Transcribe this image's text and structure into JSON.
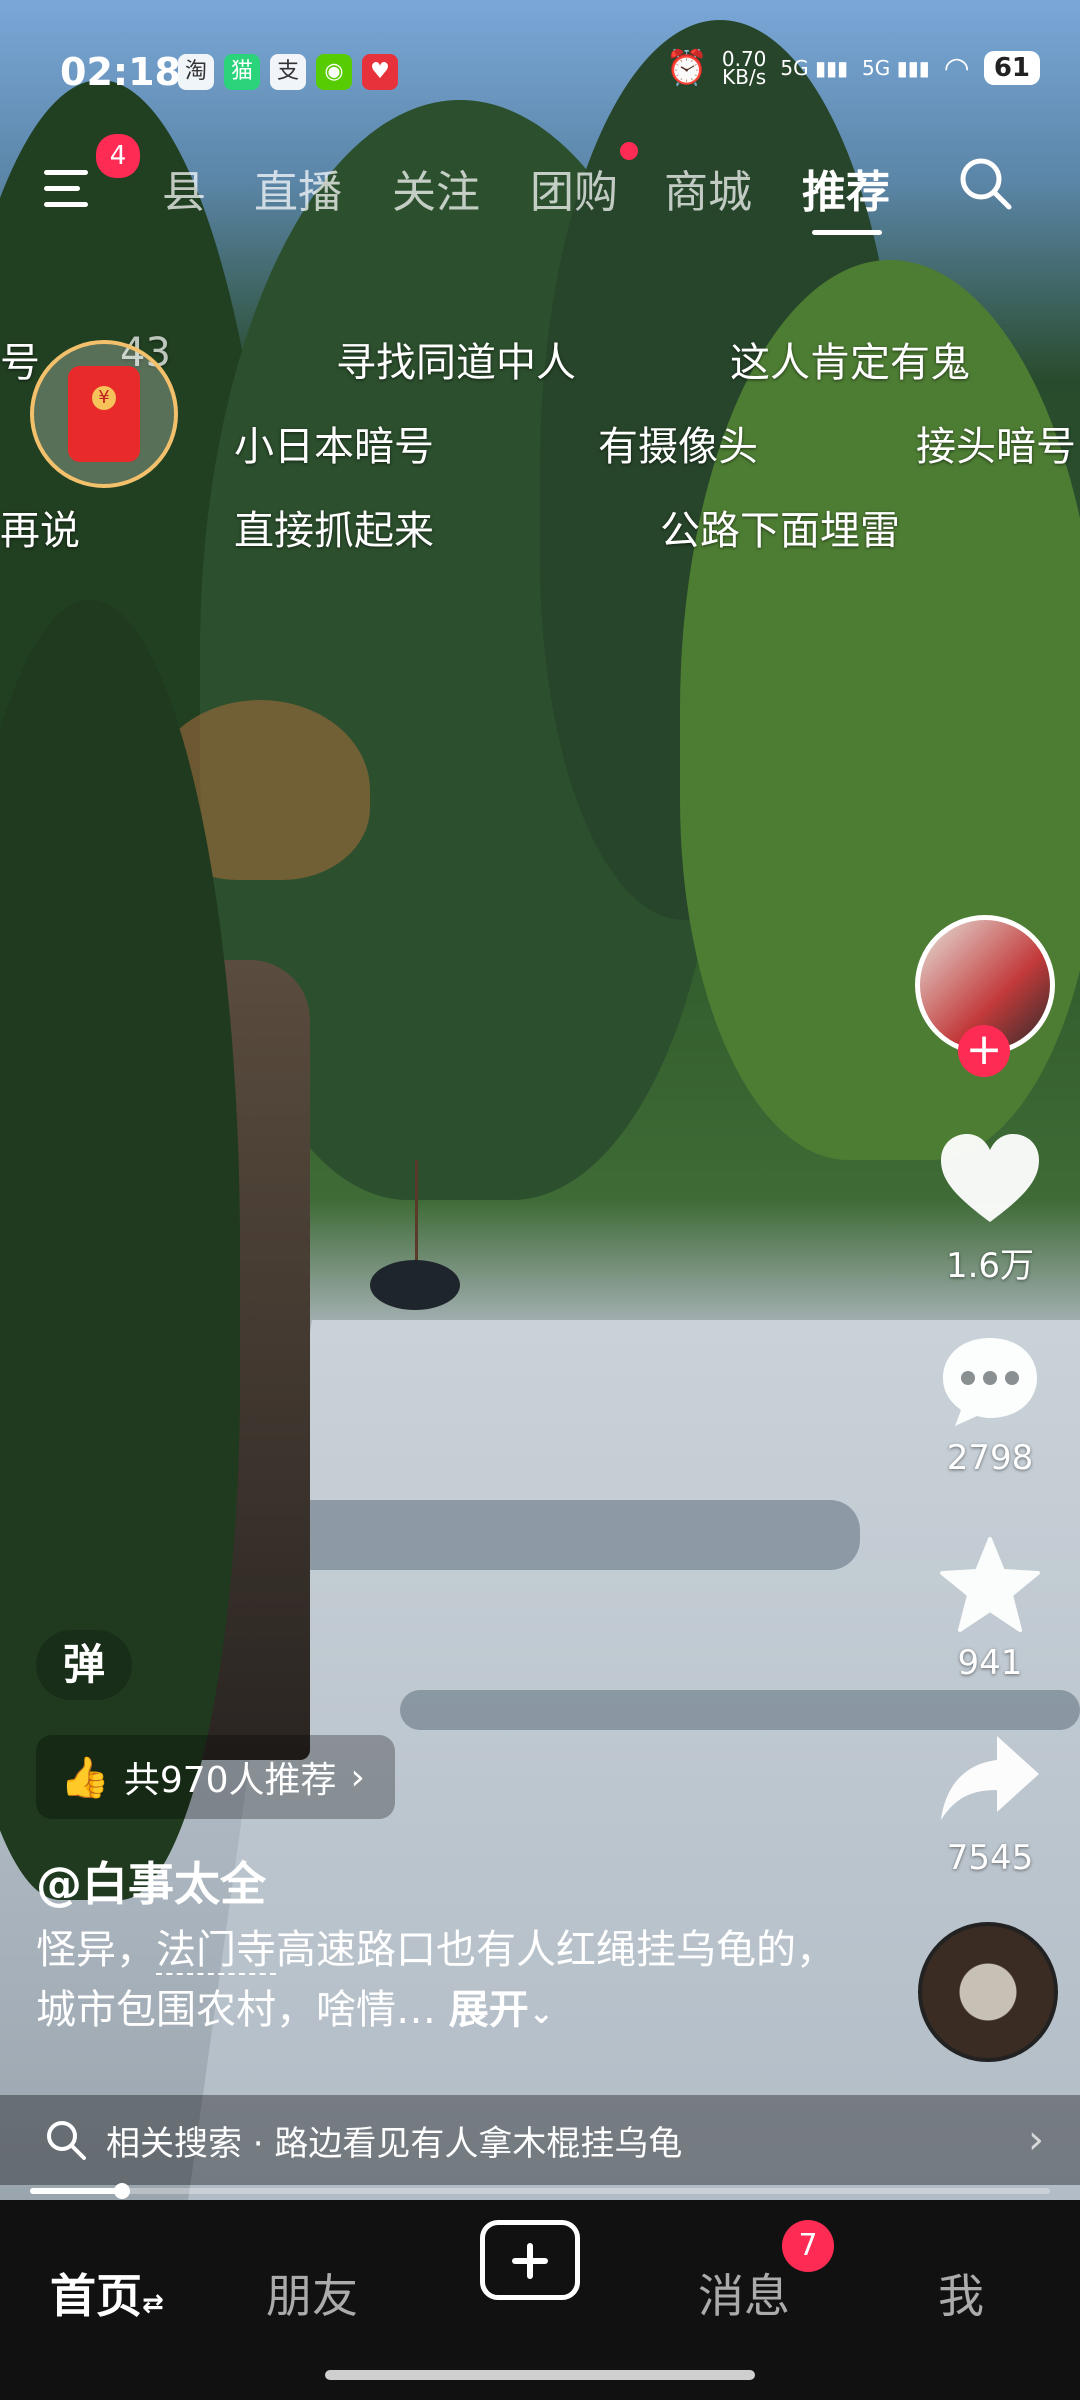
{
  "status_bar": {
    "time": "02:18",
    "apps": [
      {
        "icon": "taobao-icon",
        "glyph": "淘",
        "color": "#ffffff"
      },
      {
        "icon": "tmall-icon",
        "glyph": "猫",
        "color": "#2bd47a"
      },
      {
        "icon": "alipay-icon",
        "glyph": "支",
        "color": "#ffffff"
      },
      {
        "icon": "duolingo-icon",
        "glyph": "◉",
        "color": "#58cc02"
      },
      {
        "icon": "health-icon",
        "glyph": "♥",
        "color": "#e8323b"
      }
    ],
    "net_speed": "0.70\nKB/s",
    "signal1": "5G",
    "signal2": "5G",
    "battery": "61"
  },
  "top_nav": {
    "menu_badge": "4",
    "tabs": [
      "县",
      "直播",
      "关注",
      "团购",
      "商城",
      "推荐"
    ],
    "active_tab": "推荐"
  },
  "danmu": [
    "号",
    "43",
    "寻找同道中人",
    "这人肯定有鬼",
    "小日本暗号",
    "有摄像头",
    "接头暗号",
    "再说",
    "直接抓起来",
    "公路下面埋雷"
  ],
  "right_rail": {
    "likes": "1.6万",
    "comments": "2798",
    "favorites": "941",
    "shares": "7545"
  },
  "video_info": {
    "danmu_toggle": "弹",
    "recommend": "共970人推荐",
    "author": "@白事太全",
    "caption_pre": "怪异，",
    "caption_tag": "法门寺",
    "caption_post": "高速路口也有人红绳挂乌龟的，城市包围农村，啥情…",
    "expand": "展开",
    "related_search": "相关搜索 · 路边看见有人拿木棍挂乌龟",
    "progress": 0.09
  },
  "bottom_nav": {
    "home": "首页",
    "friends": "朋友",
    "messages": "消息",
    "messages_badge": "7",
    "me": "我"
  }
}
